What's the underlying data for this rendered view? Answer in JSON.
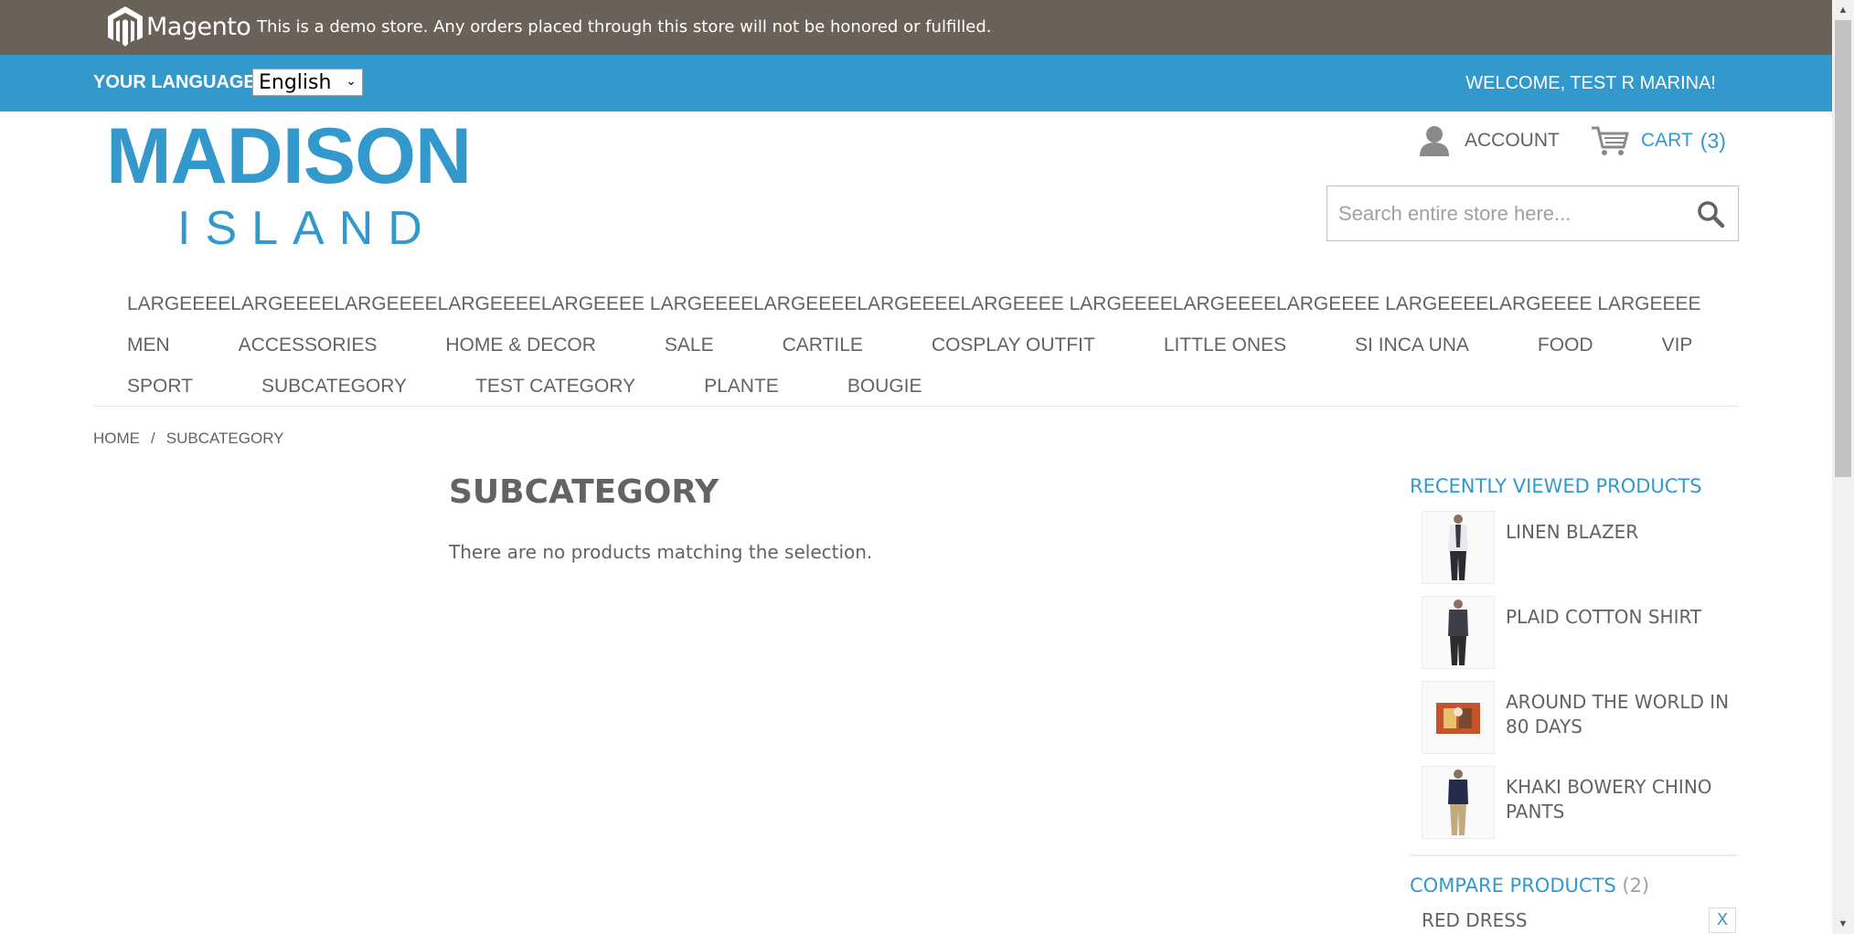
{
  "demo_notice": {
    "brand": "Magento",
    "text": "This is a demo store. Any orders placed through this store will not be honored or fulfilled."
  },
  "header_bar": {
    "language_label": "YOUR LANGUAGE:",
    "language_selected": "English",
    "welcome": "WELCOME, TEST R MARINA!"
  },
  "logo": {
    "line1": "MADISON",
    "line2": "ISLAND"
  },
  "account": {
    "label": "ACCOUNT",
    "icon": "user-icon"
  },
  "cart": {
    "label": "CART",
    "count": "(3)",
    "icon": "cart-icon"
  },
  "search": {
    "placeholder": "Search entire store here...",
    "value": "",
    "icon": "search-icon"
  },
  "nav": {
    "row1": [
      "LARGEEEELARGEEEELARGEEEELARGEEEELARGEEEE LARGEEEELARGEEEELARGEEEELARGEEEE LARGEEEELARGEEEELARGEEEE LARGEEEELARGEEEE LARGEEEE"
    ],
    "row2": [
      "MEN",
      "ACCESSORIES",
      "HOME & DECOR",
      "SALE",
      "CARTILE",
      "COSPLAY OUTFIT",
      "LITTLE ONES",
      "SI INCA UNA",
      "FOOD",
      "VIP"
    ],
    "row3": [
      "SPORT",
      "SUBCATEGORY",
      "TEST CATEGORY",
      "PLANTE",
      "BOUGIE"
    ]
  },
  "breadcrumb": {
    "home": "HOME",
    "separator": "/",
    "current": "SUBCATEGORY"
  },
  "main": {
    "title": "SUBCATEGORY",
    "message": "There are no products matching the selection."
  },
  "sidebar": {
    "recently_viewed_title": "RECENTLY VIEWED PRODUCTS",
    "recently_viewed": [
      {
        "name": "LINEN BLAZER"
      },
      {
        "name": "PLAID COTTON SHIRT"
      },
      {
        "name": "AROUND THE WORLD IN 80 DAYS"
      },
      {
        "name": "KHAKI BOWERY CHINO PANTS"
      }
    ],
    "compare_title": "COMPARE PRODUCTS",
    "compare_count": "(2)",
    "compare_items": [
      {
        "name": "RED DRESS",
        "remove": "x"
      }
    ]
  },
  "colors": {
    "accent": "#3399cc",
    "demo_bar": "#6a6158",
    "text": "#636363"
  }
}
